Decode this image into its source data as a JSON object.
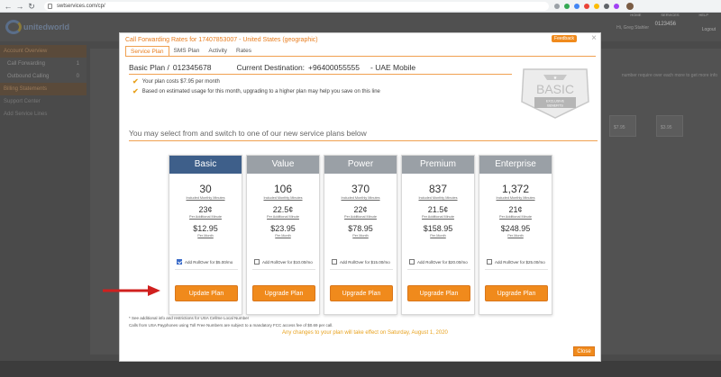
{
  "browser": {
    "url": "swtservices.com/cp/"
  },
  "site": {
    "logo_text": "unitedworld",
    "topnav": [
      "HOME",
      "SERVICES",
      "HELP"
    ],
    "account_name": "Hi, Greg Stahler",
    "account_number": "0123456",
    "logout": "Logout",
    "sidebar": [
      {
        "label": "Account Overview",
        "style": "hl"
      },
      {
        "label": "Call Forwarding",
        "count": "1",
        "style": "sub"
      },
      {
        "label": "Outbound Calling",
        "count": "0",
        "style": "sub"
      },
      {
        "label": "Billing Statements",
        "style": "hl"
      },
      {
        "label": "Support Center",
        "style": "plain"
      },
      {
        "label": "Add Service Lines",
        "style": "plain"
      }
    ],
    "bg_note": "number require over each more to get more info",
    "bg_cards": [
      "$7.95",
      "$3.95"
    ]
  },
  "modal": {
    "title": "Call Forwarding Rates for 17407853007 - United States (geographic)",
    "feedback_label": "Feedback",
    "close_glyph": "×",
    "tabs": [
      {
        "label": "Service Plan",
        "active": true
      },
      {
        "label": "SMS Plan",
        "active": false
      },
      {
        "label": "Activity",
        "active": false
      },
      {
        "label": "Rates",
        "active": false
      }
    ],
    "plan_label": "Basic Plan /",
    "plan_id": "012345678",
    "dest_label": "Current Destination:",
    "dest_number": "+96400055555",
    "dest_name": "- UAE Mobile",
    "bullets": [
      "Your plan costs $7.95 per month",
      "Based on estimated usage for this month, upgrading to a higher plan may help you save on this line"
    ],
    "badge": {
      "word": "BASIC",
      "line1": "EXCLUSIVE",
      "line2": "BENEFITS"
    },
    "select_note": "You may select from and switch to one of our new service plans below",
    "plans": [
      {
        "name": "Basic",
        "minutes": "30",
        "minutes_label": "Included Monthly Minutes",
        "rate": "23¢",
        "rate_label": "Per Additional Minute",
        "price": "$12.95",
        "price_label": "Per Month",
        "rollover": "Add RollOver for $5.00/mo",
        "checked": true,
        "button": "Update Plan",
        "current": true
      },
      {
        "name": "Value",
        "minutes": "106",
        "minutes_label": "Included Monthly Minutes",
        "rate": "22.5¢",
        "rate_label": "Per Additional Minute",
        "price": "$23.95",
        "price_label": "Per Month",
        "rollover": "Add RollOver for $10.00/mo",
        "checked": false,
        "button": "Upgrade Plan",
        "current": false
      },
      {
        "name": "Power",
        "minutes": "370",
        "minutes_label": "Included Monthly Minutes",
        "rate": "22¢",
        "rate_label": "Per Additional Minute",
        "price": "$78.95",
        "price_label": "Per Month",
        "rollover": "Add RollOver for $15.00/mo",
        "checked": false,
        "button": "Upgrade Plan",
        "current": false
      },
      {
        "name": "Premium",
        "minutes": "837",
        "minutes_label": "Included Monthly Minutes",
        "rate": "21.5¢",
        "rate_label": "Per Additional Minute",
        "price": "$158.95",
        "price_label": "Per Month",
        "rollover": "Add RollOver for $20.00/mo",
        "checked": false,
        "button": "Upgrade Plan",
        "current": false
      },
      {
        "name": "Enterprise",
        "minutes": "1,372",
        "minutes_label": "Included Monthly Minutes",
        "rate": "21¢",
        "rate_label": "Per Additional Minute",
        "price": "$248.95",
        "price_label": "Per Month",
        "rollover": "Add RollOver for $25.00/mo",
        "checked": false,
        "button": "Upgrade Plan",
        "current": false
      }
    ],
    "footnotes": [
      "* See additional info and restrictions for USA Cellme Local Number",
      "Calls from USA Payphones using Toll Free Numbers are subject to a mandatory FCC access fee of $0.69 per call."
    ],
    "effect_note": "Any changes to your plan will take effect on Saturday, August 1, 2020",
    "close_label": "Close"
  },
  "colors": {
    "accent": "#f08a1c",
    "current_plan": "#3e5f8a",
    "other_plan": "#9aa0a6",
    "arrow": "#d0201e"
  }
}
